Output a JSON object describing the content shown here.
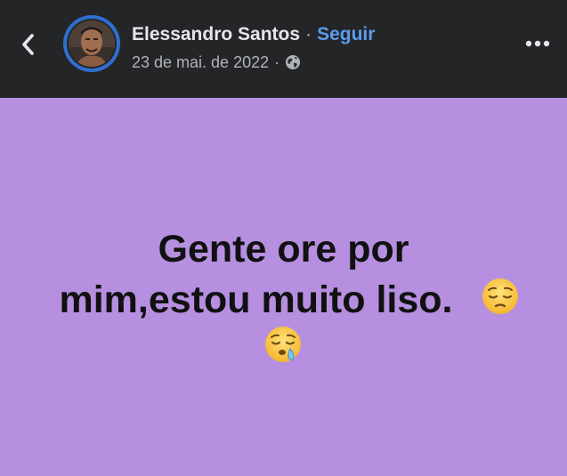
{
  "header": {
    "author_name": "Elessandro Santos",
    "separator": "·",
    "follow_label": "Seguir",
    "date": "23 de mai. de 2022",
    "date_separator": "·",
    "back_icon": "chevron-left-icon",
    "more_icon": "more-options-icon",
    "privacy_icon": "globe-icon"
  },
  "post": {
    "line_1": "Gente ore por",
    "line_2": "mim,estou muito liso.",
    "emoji_1": "pensive-face-emoji",
    "emoji_2": "sleepy-face-emoji",
    "background_color": "#b68fe0"
  },
  "colors": {
    "header_bg": "#242526",
    "follow_link": "#5a9cf0",
    "avatar_ring": "#2f6fd0"
  }
}
